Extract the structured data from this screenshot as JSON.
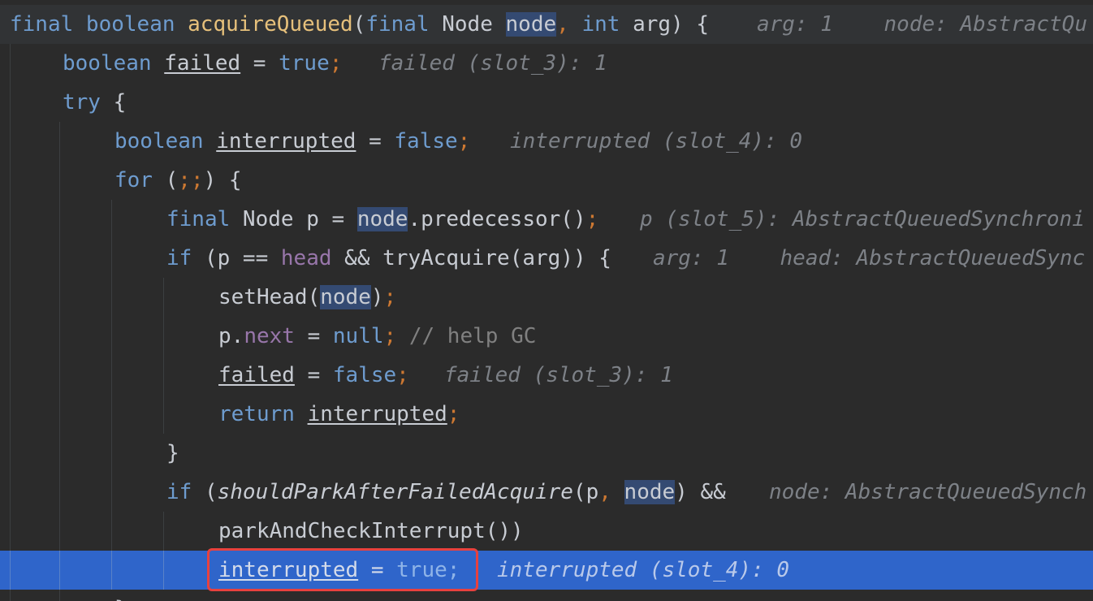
{
  "editor": {
    "language": "Java",
    "colors": {
      "background": "#2b2b2b",
      "current_line": "#2f65ca",
      "focus_box": "#e8413e",
      "keyword": "#6e9ccf",
      "method_declaration": "#e6c07b",
      "field": "#9876aa",
      "inlay_hint": "#7d8187"
    },
    "lines": [
      {
        "tokens": [
          {
            "t": "final ",
            "c": "kw"
          },
          {
            "t": "boolean ",
            "c": "kw"
          },
          {
            "t": "acquireQueued",
            "c": "fn"
          },
          {
            "t": "(",
            "c": "punct"
          },
          {
            "t": "final ",
            "c": "kw"
          },
          {
            "t": "Node ",
            "c": "plain"
          },
          {
            "t": "node",
            "c": "param-hl"
          },
          {
            "t": ", ",
            "c": "semi"
          },
          {
            "t": "int ",
            "c": "kw"
          },
          {
            "t": "arg",
            "c": "param"
          },
          {
            "t": ") {",
            "c": "punct"
          }
        ],
        "hint": "arg: 1    node: AbstractQu"
      },
      {
        "tokens": [
          {
            "t": "boolean ",
            "c": "kw"
          },
          {
            "t": "failed",
            "c": "local-var"
          },
          {
            "t": " = ",
            "c": "punct"
          },
          {
            "t": "true",
            "c": "kw"
          },
          {
            "t": ";",
            "c": "semi"
          }
        ],
        "hint": "failed (slot_3): 1"
      },
      {
        "tokens": [
          {
            "t": "try ",
            "c": "kw"
          },
          {
            "t": "{",
            "c": "punct"
          }
        ],
        "hint": ""
      },
      {
        "tokens": [
          {
            "t": "boolean ",
            "c": "kw"
          },
          {
            "t": "interrupted",
            "c": "local-var"
          },
          {
            "t": " = ",
            "c": "punct"
          },
          {
            "t": "false",
            "c": "kw"
          },
          {
            "t": ";",
            "c": "semi"
          }
        ],
        "hint": "interrupted (slot_4): 0"
      },
      {
        "tokens": [
          {
            "t": "for ",
            "c": "kw"
          },
          {
            "t": "(",
            "c": "punct"
          },
          {
            "t": ";;",
            "c": "semi"
          },
          {
            "t": ") {",
            "c": "punct"
          }
        ],
        "hint": ""
      },
      {
        "tokens": [
          {
            "t": "final ",
            "c": "kw"
          },
          {
            "t": "Node ",
            "c": "plain"
          },
          {
            "t": "p",
            "c": "plain"
          },
          {
            "t": " = ",
            "c": "punct"
          },
          {
            "t": "node",
            "c": "param-hl"
          },
          {
            "t": ".",
            "c": "punct"
          },
          {
            "t": "predecessor",
            "c": "method"
          },
          {
            "t": "()",
            "c": "punct"
          },
          {
            "t": ";",
            "c": "semi"
          }
        ],
        "hint": "p (slot_5): AbstractQueuedSynchroni"
      },
      {
        "tokens": [
          {
            "t": "if ",
            "c": "kw"
          },
          {
            "t": "(",
            "c": "punct"
          },
          {
            "t": "p",
            "c": "plain"
          },
          {
            "t": " == ",
            "c": "punct"
          },
          {
            "t": "head",
            "c": "field-ref"
          },
          {
            "t": " && ",
            "c": "punct"
          },
          {
            "t": "tryAcquire",
            "c": "method"
          },
          {
            "t": "(",
            "c": "punct"
          },
          {
            "t": "arg",
            "c": "param"
          },
          {
            "t": ")) {",
            "c": "punct"
          }
        ],
        "hint": "arg: 1    head: AbstractQueuedSync"
      },
      {
        "tokens": [
          {
            "t": "setHead",
            "c": "method"
          },
          {
            "t": "(",
            "c": "punct"
          },
          {
            "t": "node",
            "c": "param-hl"
          },
          {
            "t": ")",
            "c": "punct"
          },
          {
            "t": ";",
            "c": "semi"
          }
        ],
        "hint": ""
      },
      {
        "tokens": [
          {
            "t": "p",
            "c": "plain"
          },
          {
            "t": ".",
            "c": "punct"
          },
          {
            "t": "next",
            "c": "fld"
          },
          {
            "t": " = ",
            "c": "punct"
          },
          {
            "t": "null",
            "c": "kw"
          },
          {
            "t": ";",
            "c": "semi"
          },
          {
            "t": " // help GC",
            "c": "comment"
          }
        ],
        "hint": ""
      },
      {
        "tokens": [
          {
            "t": "failed",
            "c": "local-var"
          },
          {
            "t": " = ",
            "c": "punct"
          },
          {
            "t": "false",
            "c": "kw"
          },
          {
            "t": ";",
            "c": "semi"
          }
        ],
        "hint": "failed (slot_3): 1"
      },
      {
        "tokens": [
          {
            "t": "return ",
            "c": "kw"
          },
          {
            "t": "interrupted",
            "c": "local-var"
          },
          {
            "t": ";",
            "c": "semi"
          }
        ],
        "hint": ""
      },
      {
        "tokens": [
          {
            "t": "}",
            "c": "punct"
          }
        ],
        "hint": ""
      },
      {
        "tokens": [
          {
            "t": "if ",
            "c": "kw"
          },
          {
            "t": "(",
            "c": "punct"
          },
          {
            "t": "shouldParkAfterFailedAcquire",
            "c": "static-call"
          },
          {
            "t": "(",
            "c": "punct"
          },
          {
            "t": "p",
            "c": "plain"
          },
          {
            "t": ", ",
            "c": "semi"
          },
          {
            "t": "node",
            "c": "param-hl"
          },
          {
            "t": ") &&",
            "c": "punct"
          }
        ],
        "hint": "node: AbstractQueuedSynch"
      },
      {
        "tokens": [
          {
            "t": "parkAndCheckInterrupt",
            "c": "method"
          },
          {
            "t": "())",
            "c": "punct"
          }
        ],
        "hint": ""
      },
      {
        "tokens": [
          {
            "t": "interrupted",
            "c": "local-var"
          },
          {
            "t": " = ",
            "c": "punct"
          },
          {
            "t": "true",
            "c": "kw"
          },
          {
            "t": ";",
            "c": "semi"
          }
        ],
        "hint": "interrupted (slot_4): 0"
      },
      {
        "tokens": [
          {
            "t": "}",
            "c": "punct"
          }
        ],
        "hint": ""
      }
    ]
  }
}
